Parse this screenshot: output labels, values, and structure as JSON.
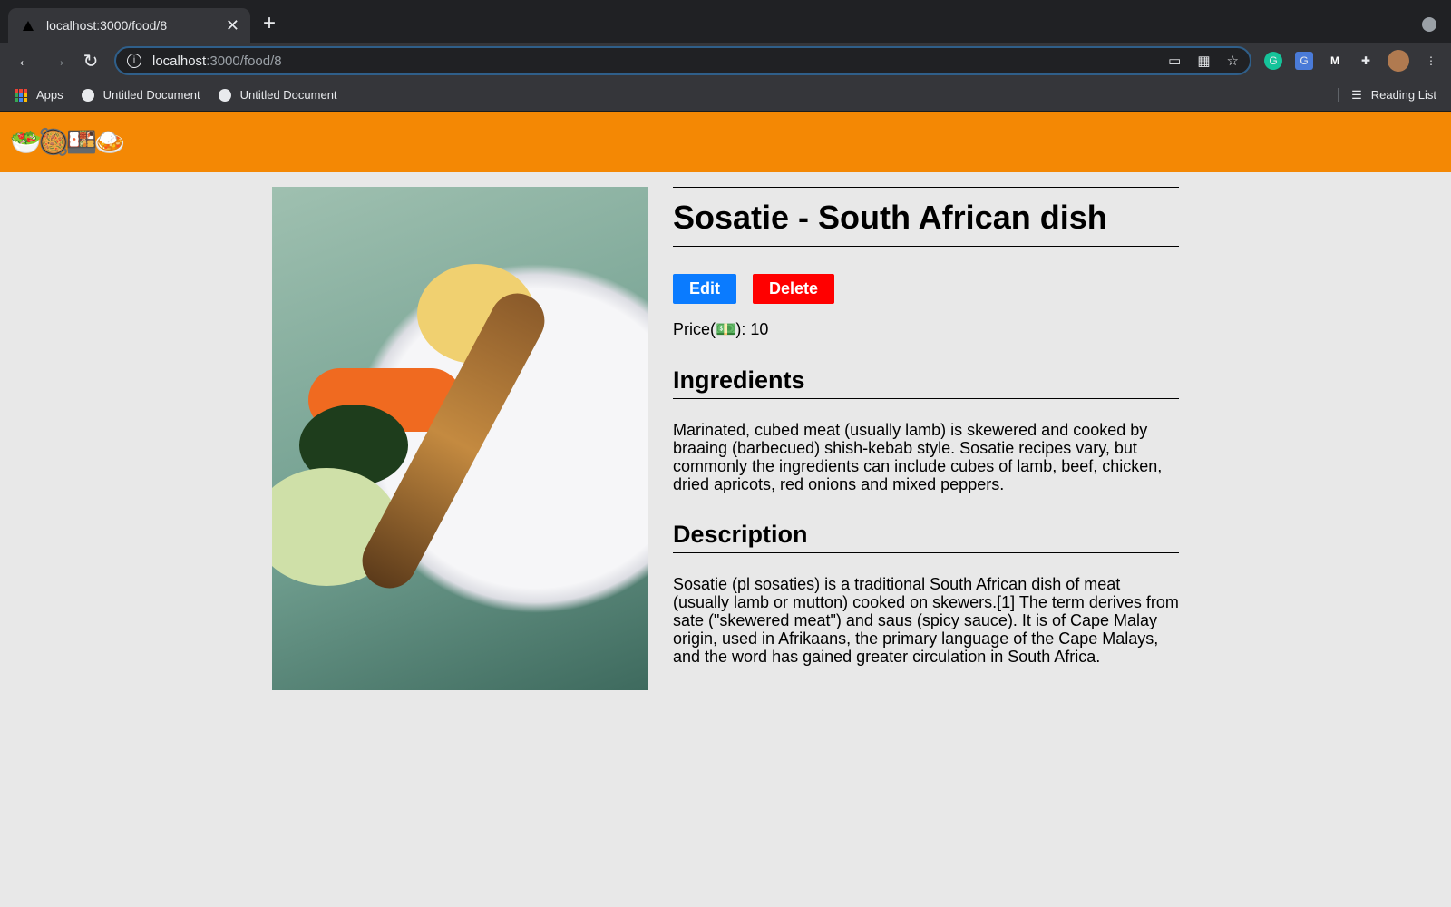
{
  "browser": {
    "tab_title": "localhost:3000/food/8",
    "url_host": "localhost",
    "url_path": ":3000/food/8",
    "bookmarks": [
      {
        "label": "Apps"
      },
      {
        "label": "Untitled Document"
      },
      {
        "label": "Untitled Document"
      }
    ],
    "reading_list": "Reading List"
  },
  "header": {
    "logo_emojis": "🥗🥘🍱🍛"
  },
  "food": {
    "title": "Sosatie - South African dish",
    "edit_label": "Edit",
    "delete_label": "Delete",
    "price_label": "Price(💵): 10",
    "ingredients_heading": "Ingredients",
    "ingredients": "Marinated, cubed meat (usually lamb) is skewered and cooked by braaing (barbecued) shish-kebab style. Sosatie recipes vary, but commonly the ingredients can include cubes of lamb, beef, chicken, dried apricots, red onions and mixed peppers.",
    "description_heading": "Description",
    "description": "Sosatie (pl sosaties) is a traditional South African dish of meat (usually lamb or mutton) cooked on skewers.[1] The term derives from sate (\"skewered meat\") and saus (spicy sauce). It is of Cape Malay origin, used in Afrikaans, the primary language of the Cape Malays, and the word has gained greater circulation in South Africa."
  },
  "colors": {
    "header": "#f48804",
    "edit": "#0a7bff",
    "delete": "#ff0000",
    "background": "#e8e8e8"
  }
}
